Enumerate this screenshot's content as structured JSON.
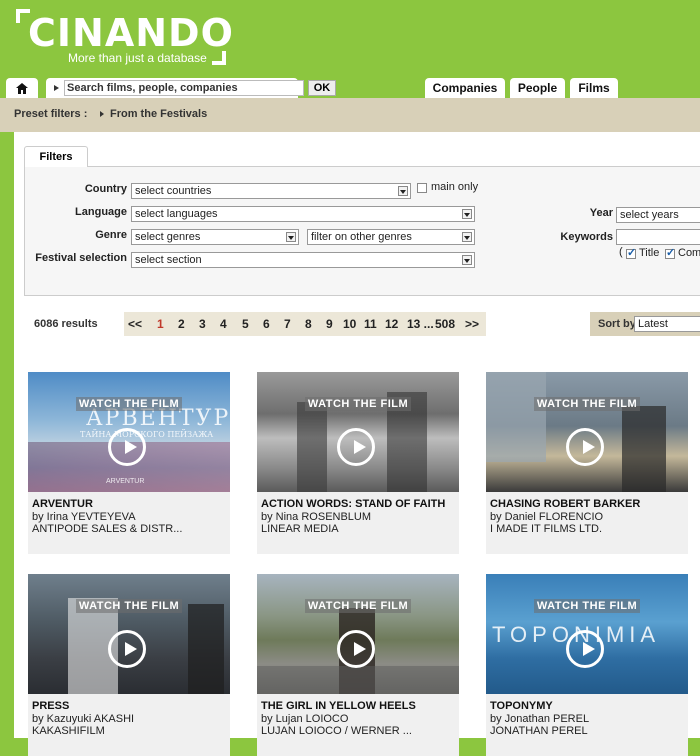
{
  "brand": {
    "name": "CINANDO",
    "tagline": "More than just a database"
  },
  "nav": {
    "home_icon": "home-icon",
    "search_placeholder": "Search films, people, companies",
    "search_ok": "OK",
    "tabs": [
      {
        "label": "Companies"
      },
      {
        "label": "People"
      },
      {
        "label": "Films"
      }
    ]
  },
  "preset": {
    "label": "Preset filters :",
    "item": "From the Festivals"
  },
  "filters": {
    "tab_label": "Filters",
    "country_label": "Country",
    "country_value": "select countries",
    "main_only": "main only",
    "language_label": "Language",
    "language_value": "select languages",
    "genre_label": "Genre",
    "genre_value": "select genres",
    "other_genres_value": "filter on other genres",
    "festival_label": "Festival selection",
    "festival_value": "select section",
    "year_label": "Year",
    "year_value": "select years",
    "keywords_label": "Keywords",
    "keywords_value": "",
    "title_check": "Title",
    "com_check": "Com",
    "paren_open": "("
  },
  "results": {
    "count": "6086 results",
    "pager": {
      "first": "<<",
      "pages": [
        "1",
        "2",
        "3",
        "4",
        "5",
        "6",
        "7",
        "8",
        "9",
        "10",
        "11",
        "12"
      ],
      "ellipsis": "13 ...",
      "last_page": "508",
      "next": ">>"
    },
    "sort_label": "Sort by",
    "sort_value": "Latest"
  },
  "films": [
    {
      "title": "ARVENTUR",
      "director": "by Irina YEVTEYEVA",
      "company": "ANTIPODE SALES & DISTR...",
      "watch": "WATCH THE FILM",
      "thumb_big": "АРВЕНТУР",
      "thumb_small": "ТАЙНА МОРСКОГО ПЕЙЗАЖА",
      "thumb_foot": "ARVENTUR"
    },
    {
      "title": "ACTION WORDS: STAND OF FAITH",
      "director": "by Nina ROSENBLUM",
      "company": "LINEAR MEDIA",
      "watch": "WATCH THE FILM"
    },
    {
      "title": "CHASING ROBERT BARKER",
      "director": "by Daniel FLORENCIO",
      "company": "I MADE IT FILMS LTD.",
      "watch": "WATCH THE FILM"
    },
    {
      "title": "PRESS",
      "director": "by Kazuyuki AKASHI",
      "company": "KAKASHIFILM",
      "watch": "WATCH THE FILM"
    },
    {
      "title": "THE GIRL IN YELLOW HEELS",
      "director": "by Lujan LOIOCO",
      "company": "LUJAN LOIOCO / WERNER ...",
      "watch": "WATCH THE FILM"
    },
    {
      "title": "TOPONYMY",
      "director": "by Jonathan PEREL",
      "company": "JONATHAN PEREL",
      "watch": "WATCH THE FILM",
      "thumb_big": "TOPONIMIA"
    }
  ]
}
